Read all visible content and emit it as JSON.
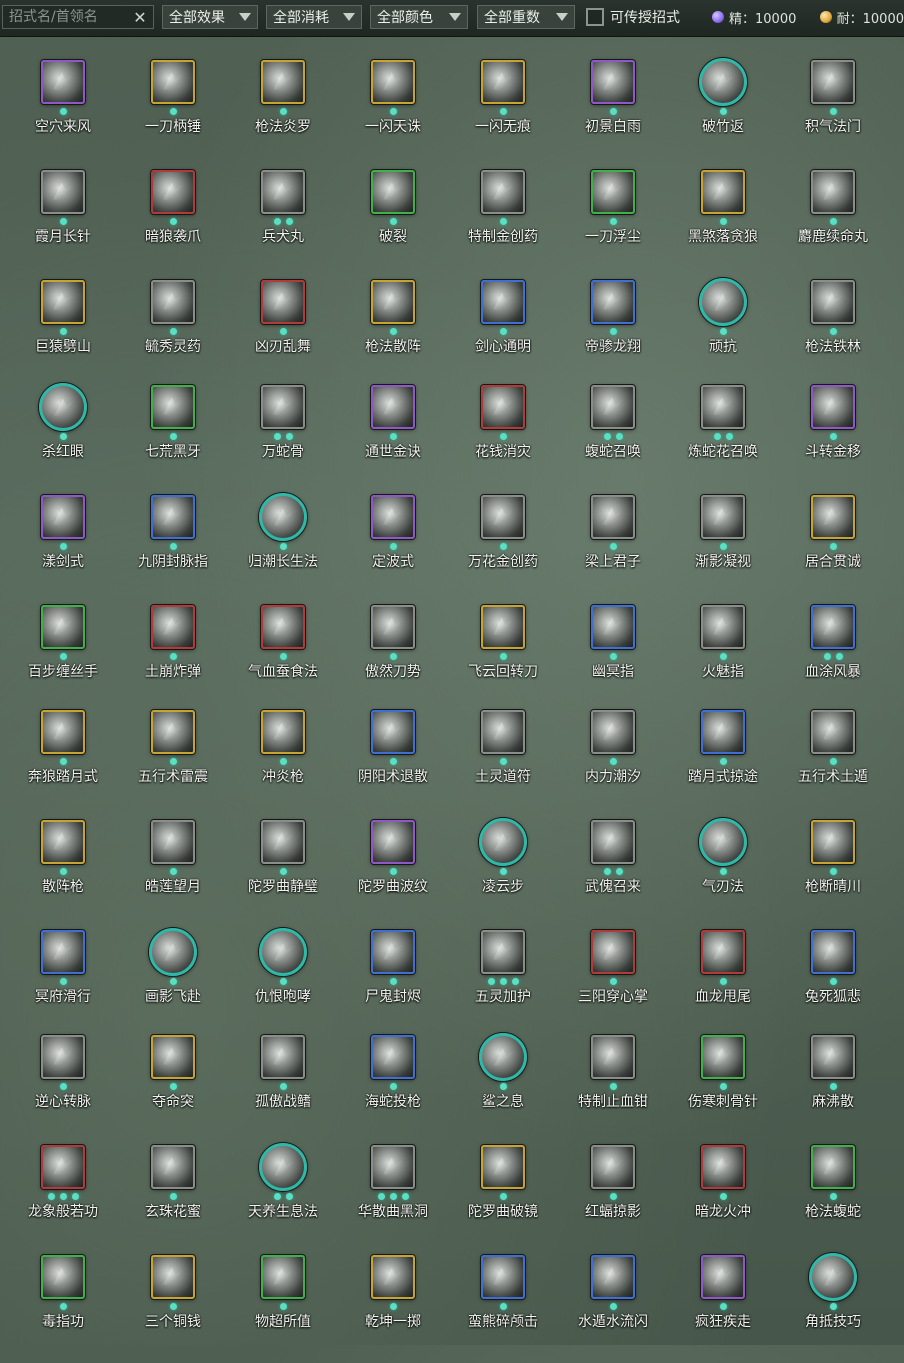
{
  "toolbar": {
    "search_placeholder": "招式名/首领名",
    "clear_glyph": "✕",
    "filters": [
      "全部效果",
      "全部消耗",
      "全部颜色",
      "全部重数"
    ],
    "checkbox_label": "可传授招式",
    "essence_label": "精：10000",
    "durability_label": "耐：10000",
    "essence_color": "#8a6cf0",
    "durability_color": "#e0a83a"
  },
  "icon_border_colors": {
    "purple": "#8f57c8",
    "gold": "#c7a431",
    "green": "#3fb04a",
    "red": "#b33a3a",
    "blue": "#3f6fd3",
    "gray": "#8a8d8a",
    "teal": "#2fb8a8"
  },
  "skills": [
    {
      "name": "空穴来风",
      "border": "purple",
      "round": false,
      "dots": 1
    },
    {
      "name": "一刀柄锤",
      "border": "gold",
      "round": false,
      "dots": 1
    },
    {
      "name": "枪法炎罗",
      "border": "gold",
      "round": false,
      "dots": 1
    },
    {
      "name": "一闪天诛",
      "border": "gold",
      "round": false,
      "dots": 1
    },
    {
      "name": "一闪无痕",
      "border": "gold",
      "round": false,
      "dots": 1
    },
    {
      "name": "初景白雨",
      "border": "purple",
      "round": false,
      "dots": 1
    },
    {
      "name": "破竹返",
      "border": "teal",
      "round": true,
      "dots": 1
    },
    {
      "name": "积气法门",
      "border": "gray",
      "round": false,
      "dots": 1
    },
    {
      "name": "霞月长针",
      "border": "gray",
      "round": false,
      "dots": 1
    },
    {
      "name": "暗狼袭爪",
      "border": "red",
      "round": false,
      "dots": 1
    },
    {
      "name": "兵犬丸",
      "border": "gray",
      "round": false,
      "dots": 2
    },
    {
      "name": "破裂",
      "border": "green",
      "round": false,
      "dots": 1
    },
    {
      "name": "特制金创药",
      "border": "gray",
      "round": false,
      "dots": 1
    },
    {
      "name": "一刀浮尘",
      "border": "green",
      "round": false,
      "dots": 1
    },
    {
      "name": "黑煞落贪狼",
      "border": "gold",
      "round": false,
      "dots": 1
    },
    {
      "name": "麝鹿续命丸",
      "border": "gray",
      "round": false,
      "dots": 1
    },
    {
      "name": "巨猿劈山",
      "border": "gold",
      "round": false,
      "dots": 1
    },
    {
      "name": "毓秀灵药",
      "border": "gray",
      "round": false,
      "dots": 1
    },
    {
      "name": "凶刃乱舞",
      "border": "red",
      "round": false,
      "dots": 1
    },
    {
      "name": "枪法散阵",
      "border": "gold",
      "round": false,
      "dots": 1
    },
    {
      "name": "剑心通明",
      "border": "blue",
      "round": false,
      "dots": 1
    },
    {
      "name": "帝骖龙翔",
      "border": "blue",
      "round": false,
      "dots": 1
    },
    {
      "name": "顽抗",
      "border": "teal",
      "round": true,
      "dots": 1
    },
    {
      "name": "枪法铁林",
      "border": "gray",
      "round": false,
      "dots": 1
    },
    {
      "name": "杀红眼",
      "border": "teal",
      "round": true,
      "dots": 1
    },
    {
      "name": "七荒黑牙",
      "border": "green",
      "round": false,
      "dots": 1
    },
    {
      "name": "万蛇骨",
      "border": "gray",
      "round": false,
      "dots": 2
    },
    {
      "name": "通世金诀",
      "border": "purple",
      "round": false,
      "dots": 1
    },
    {
      "name": "花钱消灾",
      "border": "red",
      "round": false,
      "dots": 1
    },
    {
      "name": "蝮蛇召唤",
      "border": "gray",
      "round": false,
      "dots": 2
    },
    {
      "name": "炼蛇花召唤",
      "border": "gray",
      "round": false,
      "dots": 2
    },
    {
      "name": "斗转金移",
      "border": "purple",
      "round": false,
      "dots": 1
    },
    {
      "name": "漾剑式",
      "border": "purple",
      "round": false,
      "dots": 1
    },
    {
      "name": "九阴封脉指",
      "border": "blue",
      "round": false,
      "dots": 1
    },
    {
      "name": "归潮长生法",
      "border": "teal",
      "round": true,
      "dots": 1
    },
    {
      "name": "定波式",
      "border": "purple",
      "round": false,
      "dots": 1
    },
    {
      "name": "万花金创药",
      "border": "gray",
      "round": false,
      "dots": 1
    },
    {
      "name": "梁上君子",
      "border": "gray",
      "round": false,
      "dots": 1
    },
    {
      "name": "渐影凝视",
      "border": "gray",
      "round": false,
      "dots": 1
    },
    {
      "name": "居合贯诚",
      "border": "gold",
      "round": false,
      "dots": 1
    },
    {
      "name": "百步缠丝手",
      "border": "green",
      "round": false,
      "dots": 1
    },
    {
      "name": "土崩炸弹",
      "border": "red",
      "round": false,
      "dots": 1
    },
    {
      "name": "气血蚕食法",
      "border": "red",
      "round": false,
      "dots": 1
    },
    {
      "name": "傲然刀势",
      "border": "gray",
      "round": false,
      "dots": 1
    },
    {
      "name": "飞云回转刀",
      "border": "gold",
      "round": false,
      "dots": 1
    },
    {
      "name": "幽冥指",
      "border": "blue",
      "round": false,
      "dots": 1
    },
    {
      "name": "火魅指",
      "border": "gray",
      "round": false,
      "dots": 1
    },
    {
      "name": "血涂风暴",
      "border": "blue",
      "round": false,
      "dots": 2
    },
    {
      "name": "奔狼踏月式",
      "border": "gold",
      "round": false,
      "dots": 1
    },
    {
      "name": "五行术雷震",
      "border": "gold",
      "round": false,
      "dots": 1
    },
    {
      "name": "冲炎枪",
      "border": "gold",
      "round": false,
      "dots": 1
    },
    {
      "name": "阴阳术退散",
      "border": "blue",
      "round": false,
      "dots": 1
    },
    {
      "name": "土灵道符",
      "border": "gray",
      "round": false,
      "dots": 1
    },
    {
      "name": "内力潮汐",
      "border": "gray",
      "round": false,
      "dots": 1
    },
    {
      "name": "踏月式掠途",
      "border": "blue",
      "round": false,
      "dots": 1
    },
    {
      "name": "五行术土遁",
      "border": "gray",
      "round": false,
      "dots": 1
    },
    {
      "name": "散阵枪",
      "border": "gold",
      "round": false,
      "dots": 1
    },
    {
      "name": "皓莲望月",
      "border": "gray",
      "round": false,
      "dots": 1
    },
    {
      "name": "陀罗曲静璧",
      "border": "gray",
      "round": false,
      "dots": 1
    },
    {
      "name": "陀罗曲波纹",
      "border": "purple",
      "round": false,
      "dots": 1
    },
    {
      "name": "凌云步",
      "border": "teal",
      "round": true,
      "dots": 1
    },
    {
      "name": "武傀召来",
      "border": "gray",
      "round": false,
      "dots": 2
    },
    {
      "name": "气刃法",
      "border": "teal",
      "round": true,
      "dots": 1
    },
    {
      "name": "枪断晴川",
      "border": "gold",
      "round": false,
      "dots": 1
    },
    {
      "name": "冥府滑行",
      "border": "blue",
      "round": false,
      "dots": 1
    },
    {
      "name": "画影飞赴",
      "border": "teal",
      "round": true,
      "dots": 1
    },
    {
      "name": "仇恨咆哮",
      "border": "teal",
      "round": true,
      "dots": 1
    },
    {
      "name": "尸鬼封烬",
      "border": "blue",
      "round": false,
      "dots": 1
    },
    {
      "name": "五灵加护",
      "border": "gray",
      "round": false,
      "dots": 3
    },
    {
      "name": "三阳穿心掌",
      "border": "red",
      "round": false,
      "dots": 1
    },
    {
      "name": "血龙甩尾",
      "border": "red",
      "round": false,
      "dots": 1
    },
    {
      "name": "兔死狐悲",
      "border": "blue",
      "round": false,
      "dots": 1
    },
    {
      "name": "逆心转脉",
      "border": "gray",
      "round": false,
      "dots": 1
    },
    {
      "name": "夺命突",
      "border": "gold",
      "round": false,
      "dots": 1
    },
    {
      "name": "孤傲战鳍",
      "border": "gray",
      "round": false,
      "dots": 1
    },
    {
      "name": "海蛇投枪",
      "border": "blue",
      "round": false,
      "dots": 1
    },
    {
      "name": "鲨之息",
      "border": "teal",
      "round": true,
      "dots": 1
    },
    {
      "name": "特制止血钳",
      "border": "gray",
      "round": false,
      "dots": 1
    },
    {
      "name": "伤寒刺骨针",
      "border": "green",
      "round": false,
      "dots": 1
    },
    {
      "name": "麻沸散",
      "border": "gray",
      "round": false,
      "dots": 1
    },
    {
      "name": "龙象般若功",
      "border": "red",
      "round": false,
      "dots": 3
    },
    {
      "name": "玄珠花蜜",
      "border": "gray",
      "round": false,
      "dots": 1
    },
    {
      "name": "天养生息法",
      "border": "teal",
      "round": true,
      "dots": 2
    },
    {
      "name": "华散曲黑洞",
      "border": "gray",
      "round": false,
      "dots": 3
    },
    {
      "name": "陀罗曲破镜",
      "border": "gold",
      "round": false,
      "dots": 1
    },
    {
      "name": "红蝠掠影",
      "border": "gray",
      "round": false,
      "dots": 1
    },
    {
      "name": "暗龙火冲",
      "border": "red",
      "round": false,
      "dots": 1
    },
    {
      "name": "枪法蝮蛇",
      "border": "green",
      "round": false,
      "dots": 1
    },
    {
      "name": "毒指功",
      "border": "green",
      "round": false,
      "dots": 1
    },
    {
      "name": "三个铜钱",
      "border": "gold",
      "round": false,
      "dots": 1
    },
    {
      "name": "物超所值",
      "border": "green",
      "round": false,
      "dots": 1
    },
    {
      "name": "乾坤一掷",
      "border": "gold",
      "round": false,
      "dots": 1
    },
    {
      "name": "蛮熊碎颅击",
      "border": "blue",
      "round": false,
      "dots": 1
    },
    {
      "name": "水遁水流闪",
      "border": "blue",
      "round": false,
      "dots": 1
    },
    {
      "name": "疯狂疾走",
      "border": "purple",
      "round": false,
      "dots": 1
    },
    {
      "name": "角抵技巧",
      "border": "teal",
      "round": true,
      "dots": 1
    }
  ]
}
